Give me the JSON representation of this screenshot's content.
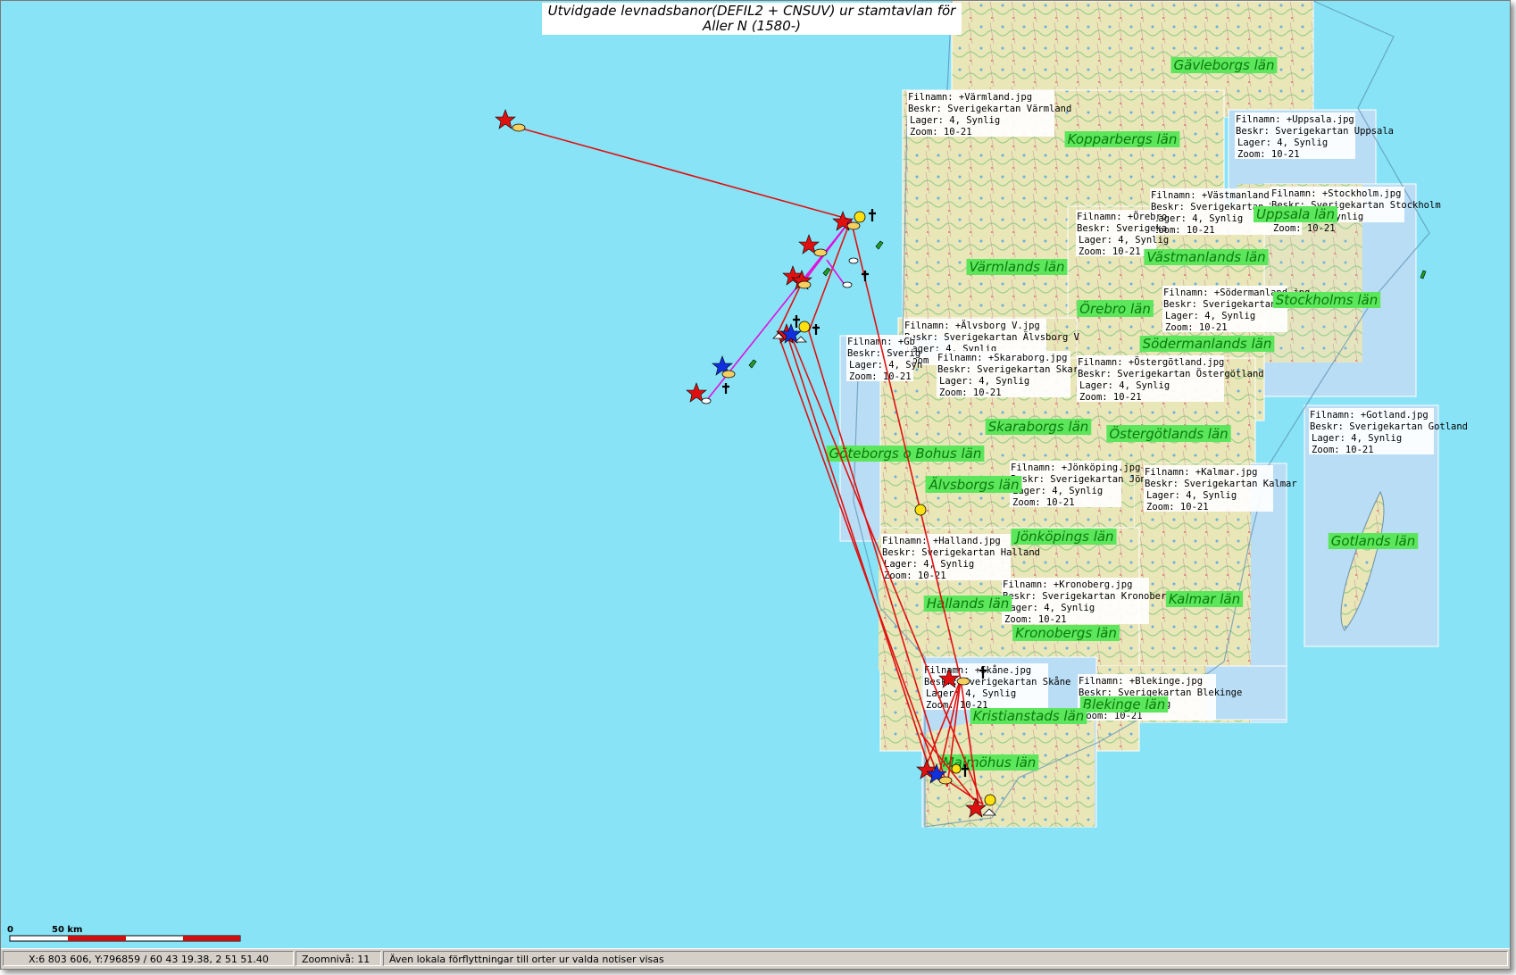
{
  "title": {
    "line1": "Utvidgade levnadsbanor(DEFIL2 + CNSUV) ur stamtavlan för",
    "line2": "Aller N (1580-)"
  },
  "colors": {
    "sea": "#88e3f7",
    "route_line": "#e01010",
    "route_line_alt": "#e010e0",
    "label_bg": "#5ce65c",
    "label_text": "#0a7a0a",
    "map_land": "#e7e3b4"
  },
  "map_sheets": [
    {
      "file": "Filnamn: +Värmland.jpg",
      "desc": "Beskr: Sverigekartan Värmland",
      "layer": "Lager: 4, Synlig",
      "zoom": "Zoom: 10-21"
    },
    {
      "file": "Filnamn: +Uppsala.jpg",
      "desc": "Beskr: Sverigekartan Uppsala",
      "layer": "Lager: 4, Synlig",
      "zoom": "Zoom: 10-21"
    },
    {
      "file": "Filnamn: +Västmanland.jpg",
      "desc": "Beskr: Sverigekartan Västmanland",
      "layer": "Lager: 4, Synlig",
      "zoom": "Zoom: 10-21"
    },
    {
      "file": "Filnamn: +Stockholm.jpg",
      "desc": "Beskr: Sverigekartan Stockholm",
      "layer": "Lager: 4, Synlig",
      "zoom": "Zoom: 10-21"
    },
    {
      "file": "Filnamn: +Örebro",
      "desc": "Beskr: Sverigeka",
      "layer": "Lager: 4, Synlig",
      "zoom": "Zoom: 10-21"
    },
    {
      "file": "Filnamn: +Södermanland.jpg",
      "desc": "Beskr: Sverigekartan Söde",
      "layer": "Lager: 4, Synlig",
      "zoom": "Zoom: 10-21"
    },
    {
      "file": "Filnamn: +Älvsborg V.jpg",
      "desc": "Beskr: Sverigekartan Älvsborg V",
      "layer": "Lager: 4, Synlig",
      "zoom": "Zoom"
    },
    {
      "file": "Filnamn: +Skaraborg.jpg",
      "desc": "Beskr: Sverigekartan Skaraborg",
      "layer": "Lager: 4, Synlig",
      "zoom": "Zoom: 10-21"
    },
    {
      "file": "Filnamn: +Östergötland.jpg",
      "desc": "Beskr: Sverigekartan Östergötland",
      "layer": "Lager: 4, Synlig",
      "zoom": "Zoom: 10-21"
    },
    {
      "file": "Filnamn: +Gb",
      "desc": "Beskr: Sverig",
      "layer": "Lager: 4, Syn",
      "zoom": "Zoom: 10-21"
    },
    {
      "file": "Filnamn: +Gotland.jpg",
      "desc": "Beskr: Sverigekartan Gotland",
      "layer": "Lager: 4, Synlig",
      "zoom": "Zoom: 10-21"
    },
    {
      "file": "Filnamn: +Jönköping.jpg",
      "desc": "Beskr: Sverigekartan Jönköping",
      "layer": "Lager: 4, Synlig",
      "zoom": "Zoom: 10-21"
    },
    {
      "file": "Filnamn: +Kalmar.jpg",
      "desc": "Beskr: Sverigekartan Kalmar",
      "layer": "Lager: 4, Synlig",
      "zoom": "Zoom: 10-21"
    },
    {
      "file": "Filnamn: +Halland.jpg",
      "desc": "Beskr: Sverigekartan Halland",
      "layer": "Lager: 4, Synlig",
      "zoom": "Zoom: 10-21"
    },
    {
      "file": "Filnamn: +Kronoberg.jpg",
      "desc": "Beskr: Sverigekartan Kronoberg",
      "layer": "Lager: 4, Synlig",
      "zoom": "Zoom: 10-21"
    },
    {
      "file": "Filnamn: +Skåne.jpg",
      "desc": "Beskr: Sverigekartan Skåne",
      "layer": "Lager: 4, Synlig",
      "zoom": "Zoom: 10-21"
    },
    {
      "file": "Filnamn: +Blekinge.jpg",
      "desc": "Beskr: Sverigekartan Blekinge",
      "layer": "Lager: 4, Synlig",
      "zoom": "Zoom: 10-21"
    }
  ],
  "county_labels": [
    "Gävleborgs län",
    "Kopparbergs län",
    "Uppsala län",
    "Värmlands län",
    "Västmanlands län",
    "Stockholms län",
    "Örebro län",
    "Södermanlands län",
    "Skaraborgs län",
    "Östergötlands län",
    "Göteborgs o Bohus län",
    "Älvsborgs län",
    "Jönköpings län",
    "Gotlands län",
    "Hallands län",
    "Kalmar län",
    "Kronobergs län",
    "Blekinge län",
    "Kristianstads län",
    "Malmöhus län"
  ],
  "scale_bar": {
    "zero": "0",
    "label": "50 km"
  },
  "status": {
    "coords": "X:6 803 606, Y:796859 / 60 43 19.38, 2 51 51.40",
    "zoom": "Zoomnivå: 11",
    "message": "Även lokala förflyttningar till orter ur valda notiser visas"
  }
}
